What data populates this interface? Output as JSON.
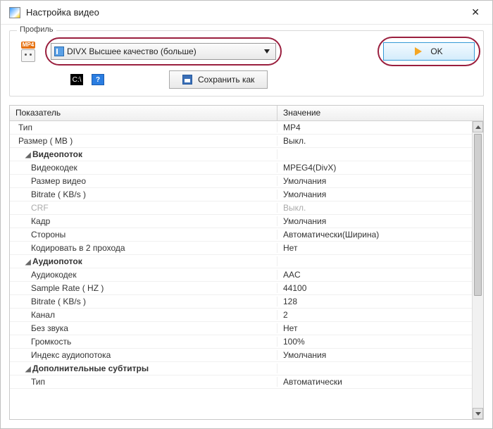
{
  "window": {
    "title": "Настройка видео"
  },
  "profile": {
    "legend": "Профиль",
    "file_badge": "MP4",
    "combo_value": "DIVX Высшее качество (больше)",
    "ok_label": "OK",
    "cmd_glyph": "C:\\",
    "help_glyph": "?",
    "save_label": "Сохранить как"
  },
  "grid": {
    "header_key": "Показатель",
    "header_val": "Значение",
    "rows": [
      {
        "k": "Тип",
        "v": "MP4",
        "cls": "top"
      },
      {
        "k": "Размер ( MB )",
        "v": "Выкл.",
        "cls": "top"
      },
      {
        "k": "Видеопоток",
        "v": "",
        "cls": "section"
      },
      {
        "k": "Видеокодек",
        "v": "MPEG4(DivX)"
      },
      {
        "k": "Размер видео",
        "v": "Умолчания"
      },
      {
        "k": "Bitrate ( KB/s )",
        "v": "Умолчания"
      },
      {
        "k": "CRF",
        "v": "Выкл.",
        "cls": "muted"
      },
      {
        "k": "Кадр",
        "v": "Умолчания"
      },
      {
        "k": "Стороны",
        "v": "Автоматически(Ширина)"
      },
      {
        "k": "Кодировать в 2 прохода",
        "v": "Нет"
      },
      {
        "k": "Аудиопоток",
        "v": "",
        "cls": "section"
      },
      {
        "k": "Аудиокодек",
        "v": "AAC"
      },
      {
        "k": "Sample Rate ( HZ )",
        "v": "44100"
      },
      {
        "k": "Bitrate ( KB/s )",
        "v": "128"
      },
      {
        "k": "Канал",
        "v": "2"
      },
      {
        "k": "Без звука",
        "v": "Нет"
      },
      {
        "k": "Громкость",
        "v": "100%"
      },
      {
        "k": "Индекс аудиопотока",
        "v": "Умолчания"
      },
      {
        "k": "Дополнительные субтитры",
        "v": "",
        "cls": "section"
      },
      {
        "k": "Тип",
        "v": "Автоматически"
      }
    ]
  }
}
